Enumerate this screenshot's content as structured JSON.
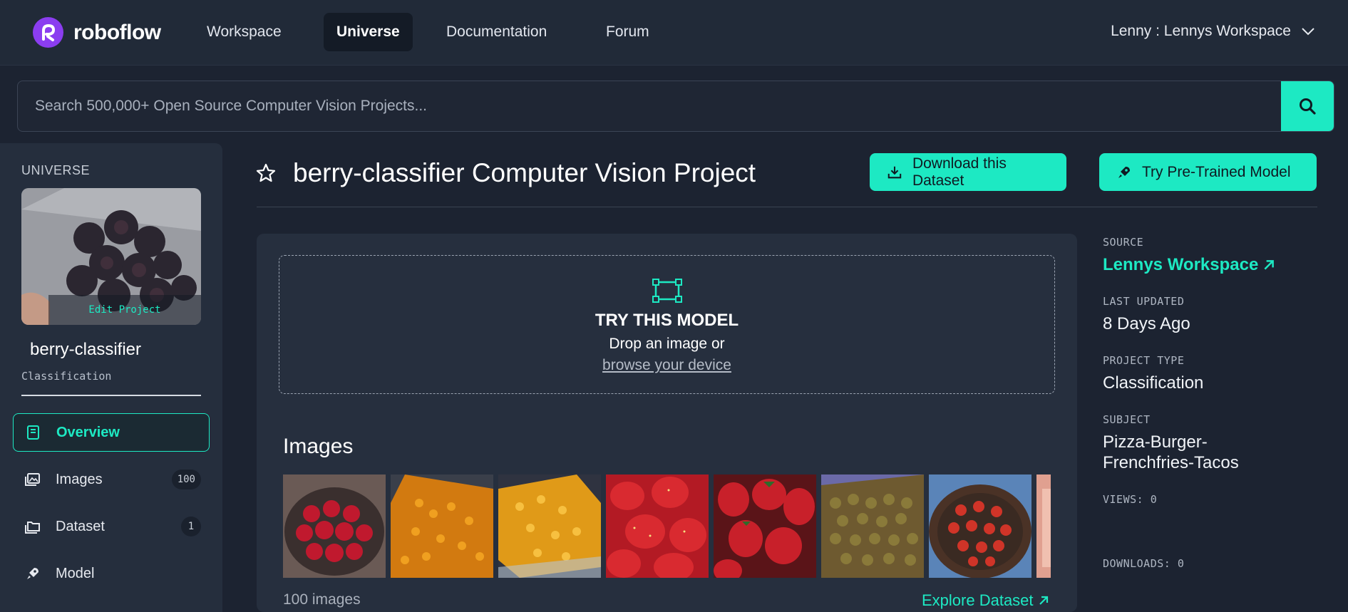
{
  "nav": {
    "brand": "roboflow",
    "items": [
      {
        "label": "Workspace",
        "active": false
      },
      {
        "label": "Universe",
        "active": true
      },
      {
        "label": "Documentation",
        "active": false
      },
      {
        "label": "Forum",
        "active": false
      }
    ],
    "user": "Lenny : Lennys Workspace"
  },
  "search": {
    "placeholder": "Search 500,000+ Open Source Computer Vision Projects..."
  },
  "sidebar": {
    "section": "UNIVERSE",
    "edit_label": "Edit Project",
    "project_name": "berry-classifier",
    "project_type": "Classification",
    "items": [
      {
        "label": "Overview",
        "icon": "book-icon",
        "active": true
      },
      {
        "label": "Images",
        "icon": "images-icon",
        "count": "100"
      },
      {
        "label": "Dataset",
        "icon": "folders-icon",
        "count": "1"
      },
      {
        "label": "Model",
        "icon": "rocket-icon"
      }
    ]
  },
  "header": {
    "title": "berry-classifier Computer Vision Project",
    "download_label": "Download this Dataset",
    "try_label": "Try Pre-Trained Model"
  },
  "dropzone": {
    "title": "TRY THIS MODEL",
    "subtitle": "Drop an image or",
    "link": "browse your device"
  },
  "images": {
    "heading": "Images",
    "count_text": "100 images",
    "explore_label": "Explore Dataset"
  },
  "meta": {
    "source_label": "SOURCE",
    "source_value": "Lennys Workspace",
    "updated_label": "LAST UPDATED",
    "updated_value": "8 Days Ago",
    "type_label": "PROJECT TYPE",
    "type_value": "Classification",
    "subject_label": "SUBJECT",
    "subject_value_line1": "Pizza-Burger-",
    "subject_value_line2": "Frenchfries-Tacos",
    "views": "VIEWS: 0",
    "downloads": "DOWNLOADS: 0"
  },
  "colors": {
    "accent": "#1de9c3",
    "background": "#1c2331",
    "panel": "#262f3e",
    "brand_purple": "#8b3df0"
  }
}
